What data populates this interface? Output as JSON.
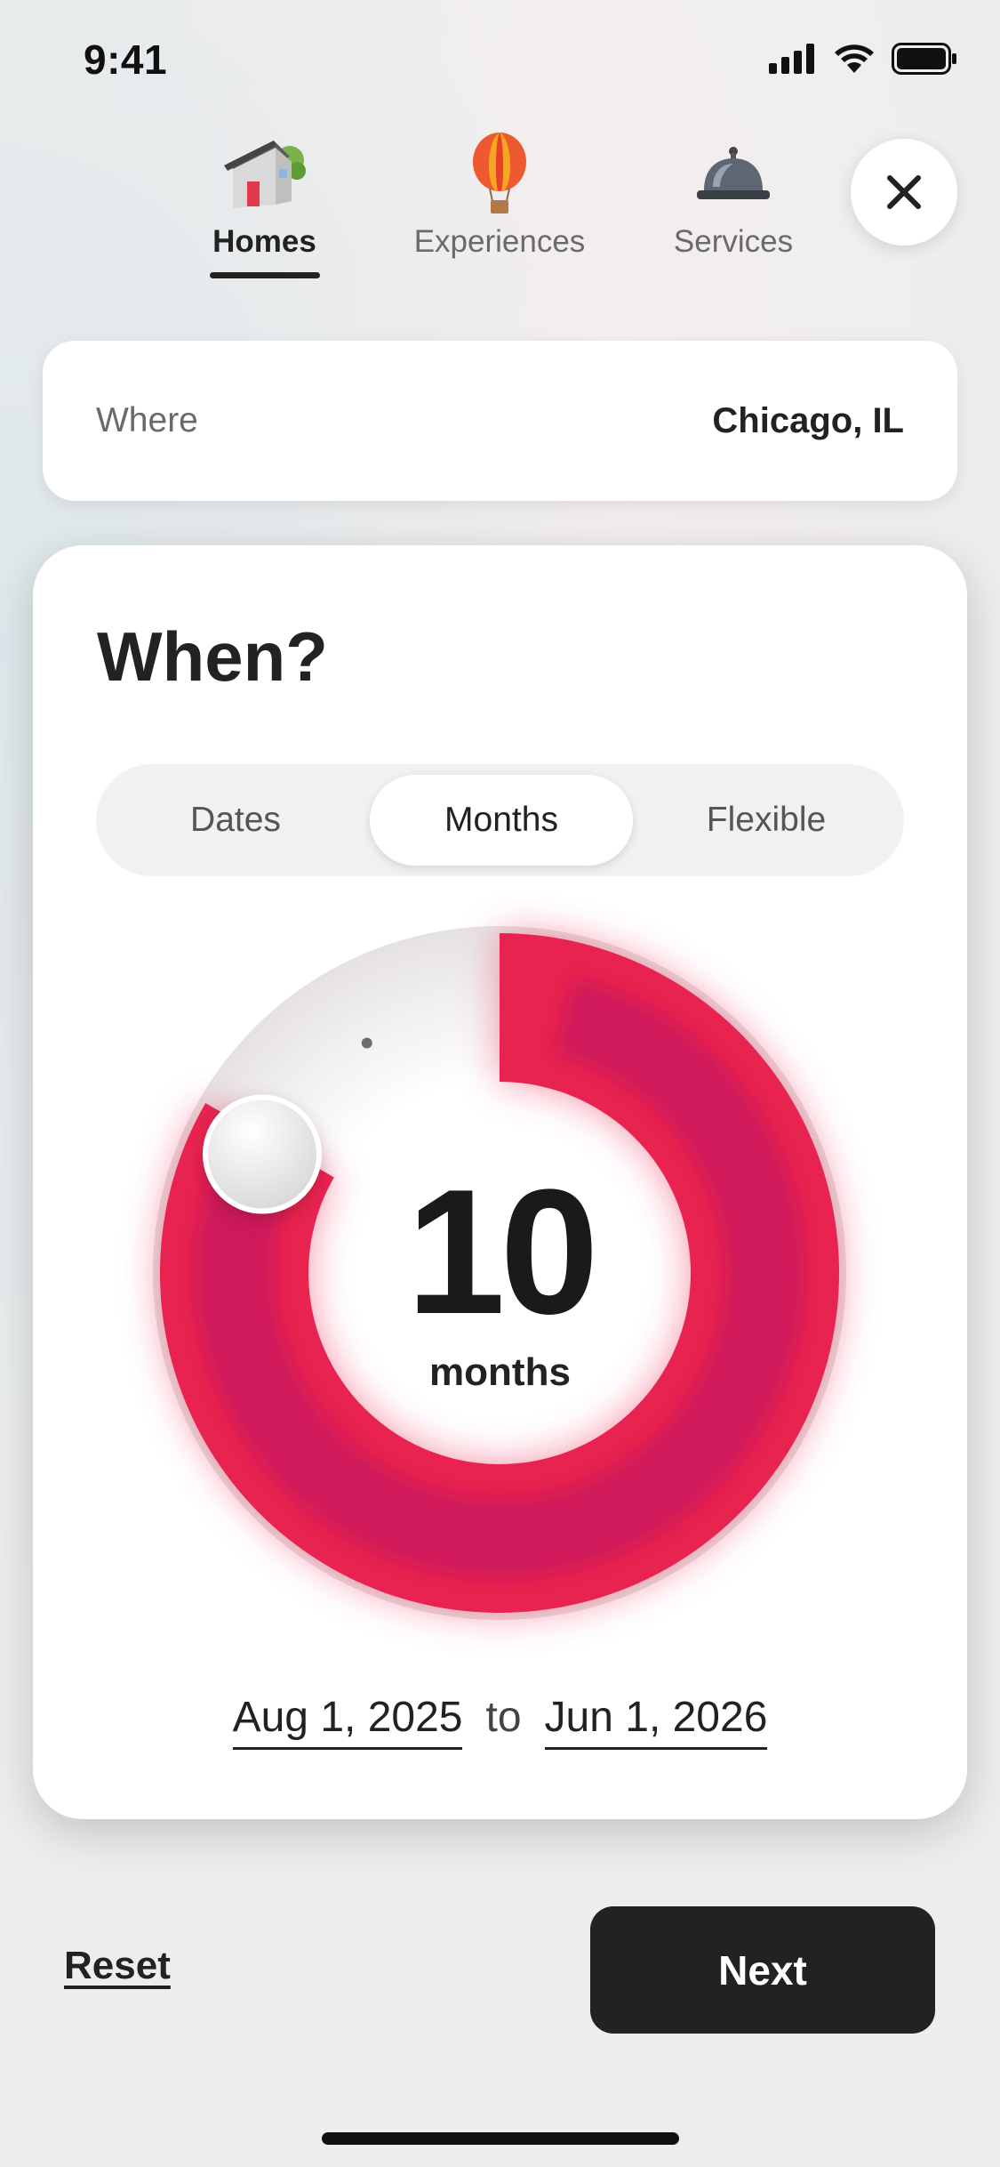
{
  "status_bar": {
    "time": "9:41"
  },
  "tabs": [
    {
      "label": "Homes",
      "icon": "house-icon",
      "active": true
    },
    {
      "label": "Experiences",
      "icon": "hot-air-balloon-icon",
      "active": false
    },
    {
      "label": "Services",
      "icon": "service-bell-icon",
      "active": false
    }
  ],
  "where": {
    "label": "Where",
    "value": "Chicago, IL"
  },
  "when": {
    "title": "When?",
    "segments": [
      {
        "label": "Dates",
        "selected": false
      },
      {
        "label": "Months",
        "selected": true
      },
      {
        "label": "Flexible",
        "selected": false
      }
    ],
    "dial": {
      "value": "10",
      "unit": "months",
      "max_months": 12,
      "selected_months": 10
    },
    "range": {
      "start": "Aug 1, 2025",
      "connector": "to",
      "end": "Jun 1, 2026"
    }
  },
  "footer": {
    "reset_label": "Reset",
    "next_label": "Next"
  },
  "colors": {
    "accent": "#e8234f",
    "accent_dark": "#c2135e",
    "button": "#222222"
  }
}
